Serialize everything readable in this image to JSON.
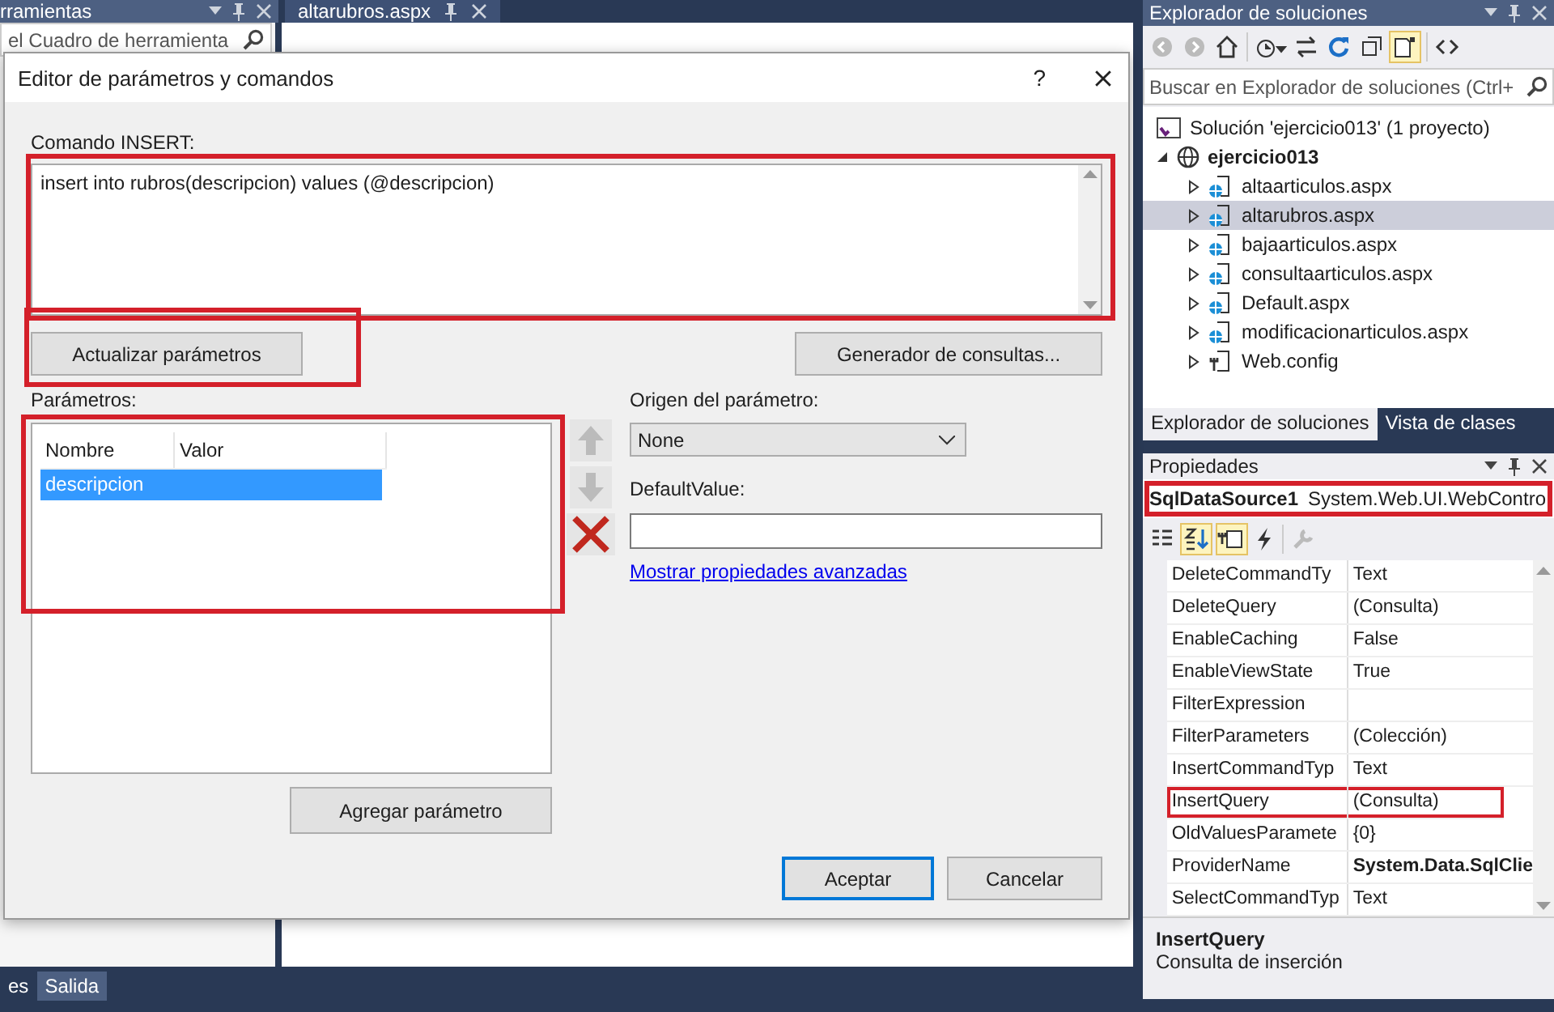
{
  "toolbox": {
    "title": "rramientas",
    "search_placeholder": "el Cuadro de herramienta"
  },
  "document_tab": {
    "title": "altarubros.aspx"
  },
  "dialog": {
    "title": "Editor de parámetros y comandos",
    "help": "?",
    "command_label": "Comando INSERT:",
    "command_text": "insert into rubros(descripcion) values (@descripcion)",
    "refresh_button": "Actualizar parámetros",
    "query_builder_button": "Generador de consultas...",
    "parameters_label": "Parámetros:",
    "columns": [
      "Nombre",
      "Valor"
    ],
    "parameters": [
      {
        "name": "descripcion",
        "selected": true
      }
    ],
    "source_label": "Origen del parámetro:",
    "source_value": "None",
    "default_label": "DefaultValue:",
    "advanced_link": "Mostrar propiedades avanzadas",
    "add_button": "Agregar parámetro",
    "ok_button": "Aceptar",
    "cancel_button": "Cancelar"
  },
  "solution_explorer": {
    "title": "Explorador de soluciones",
    "search_placeholder": "Buscar en Explorador de soluciones (Ctrl+",
    "solution": "Solución 'ejercicio013'  (1 proyecto)",
    "project": {
      "name": "ejercicio013",
      "expanded": true
    },
    "items": [
      {
        "name": "altaarticulos.aspx",
        "kind": "page",
        "selected": false
      },
      {
        "name": "altarubros.aspx",
        "kind": "page",
        "selected": true
      },
      {
        "name": "bajaarticulos.aspx",
        "kind": "page",
        "selected": false
      },
      {
        "name": "consultaarticulos.aspx",
        "kind": "page",
        "selected": false
      },
      {
        "name": "Default.aspx",
        "kind": "page",
        "selected": false
      },
      {
        "name": "modificacionarticulos.aspx",
        "kind": "page",
        "selected": false
      },
      {
        "name": "Web.config",
        "kind": "config",
        "selected": false
      }
    ],
    "tabs": [
      {
        "label": "Explorador de soluciones",
        "selected": true
      },
      {
        "label": "Vista de clases",
        "selected": false
      }
    ]
  },
  "properties": {
    "title": "Propiedades",
    "object_name": "SqlDataSource1",
    "object_type": "System.Web.UI.WebContro",
    "rows": [
      {
        "name": "DeleteCommandTy",
        "value": "Text",
        "bold": false,
        "highlighted": false
      },
      {
        "name": "DeleteQuery",
        "value": "(Consulta)",
        "bold": false,
        "highlighted": false
      },
      {
        "name": "EnableCaching",
        "value": "False",
        "bold": false,
        "highlighted": false
      },
      {
        "name": "EnableViewState",
        "value": "True",
        "bold": false,
        "highlighted": false
      },
      {
        "name": "FilterExpression",
        "highlighted": false
      },
      {
        "name": "FilterParameters",
        "value": "(Colección)",
        "bold": false,
        "highlighted": false
      },
      {
        "name": "InsertCommandTyp",
        "value": "Text",
        "bold": false,
        "highlighted": false
      },
      {
        "name": "InsertQuery",
        "value": "(Consulta)",
        "bold": false,
        "highlighted": true
      },
      {
        "name": "OldValuesParamete",
        "value": "{0}",
        "bold": false,
        "highlighted": false
      },
      {
        "name": "ProviderName",
        "value": "System.Data.SqlClie",
        "bold": true,
        "highlighted": false
      },
      {
        "name": "SelectCommandTyp",
        "value": "Text",
        "bold": false,
        "highlighted": false
      }
    ],
    "description_title": "InsertQuery",
    "description": "Consulta de inserción"
  },
  "bottom_tabs": [
    {
      "label": "es",
      "selected": false
    },
    {
      "label": "Salida",
      "selected": true
    }
  ]
}
